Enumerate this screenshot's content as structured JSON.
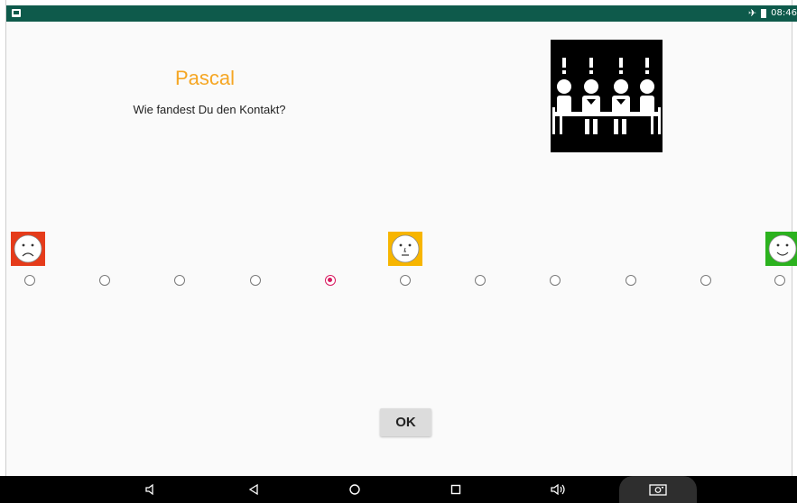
{
  "status_bar": {
    "clock": "08:46",
    "icons": [
      "image-notification-icon",
      "airplane-mode-icon",
      "battery-icon"
    ]
  },
  "rating_screen": {
    "name": "Pascal",
    "question": "Wie fandest Du den Kontakt?",
    "pictogram": "meeting-pictogram-icon",
    "scale": {
      "faces": [
        "sad-face-icon",
        "neutral-face-icon",
        "happy-face-icon"
      ],
      "face_colors": [
        "#e53b1a",
        "#f7b500",
        "#2bb21e"
      ],
      "option_count": 11,
      "selected_index": 4
    },
    "ok_label": "OK"
  },
  "nav_bar": {
    "buttons": [
      "volume-down-icon",
      "back-icon",
      "home-icon",
      "recents-icon",
      "volume-up-icon",
      "screenshot-icon"
    ]
  },
  "colors": {
    "status_bar": "#0e5a4b",
    "title": "#f5a623",
    "radio_selected": "#d81b60"
  }
}
